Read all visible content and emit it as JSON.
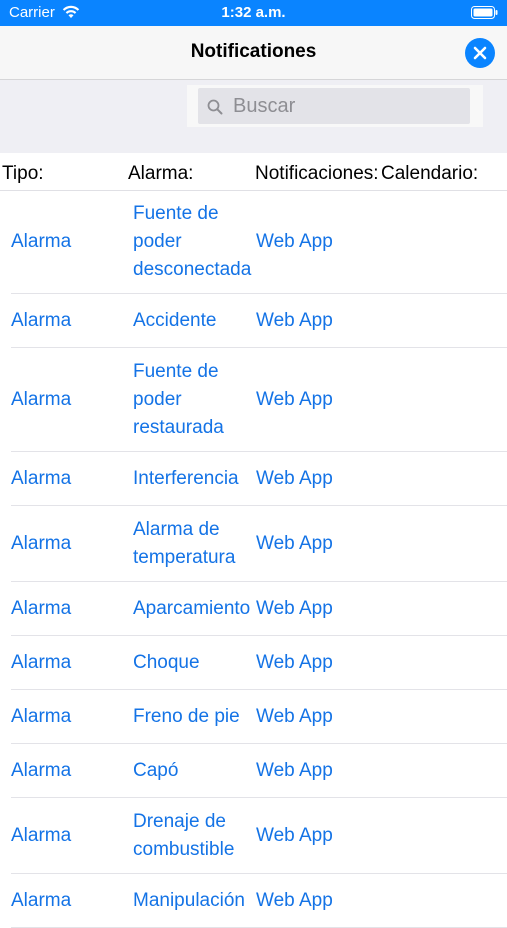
{
  "status_bar": {
    "carrier": "Carrier",
    "time": "1:32 a.m."
  },
  "nav": {
    "title": "Notificationes"
  },
  "search": {
    "placeholder": "Buscar"
  },
  "table": {
    "headers": [
      "Tipo:",
      "Alarma:",
      "Notificaciones:",
      "Calendario:"
    ],
    "rows": [
      {
        "tipo": "Alarma",
        "alarma": "Fuente de\npoder\ndesconectada",
        "notificaciones": "Web App",
        "calendario": ""
      },
      {
        "tipo": "Alarma",
        "alarma": "Accidente",
        "notificaciones": "Web App",
        "calendario": ""
      },
      {
        "tipo": "Alarma",
        "alarma": "Fuente de\npoder\nrestaurada",
        "notificaciones": "Web App",
        "calendario": ""
      },
      {
        "tipo": "Alarma",
        "alarma": "Interferencia",
        "notificaciones": "Web App",
        "calendario": ""
      },
      {
        "tipo": "Alarma",
        "alarma": "Alarma de\ntemperatura",
        "notificaciones": "Web App",
        "calendario": ""
      },
      {
        "tipo": "Alarma",
        "alarma": "Aparcamiento",
        "notificaciones": "Web App",
        "calendario": ""
      },
      {
        "tipo": "Alarma",
        "alarma": "Choque",
        "notificaciones": "Web App",
        "calendario": ""
      },
      {
        "tipo": "Alarma",
        "alarma": "Freno de pie",
        "notificaciones": "Web App",
        "calendario": ""
      },
      {
        "tipo": "Alarma",
        "alarma": "Capó",
        "notificaciones": "Web App",
        "calendario": ""
      },
      {
        "tipo": "Alarma",
        "alarma": "Drenaje de\ncombustible",
        "notificaciones": "Web App",
        "calendario": ""
      },
      {
        "tipo": "Alarma",
        "alarma": "Manipulación",
        "notificaciones": "Web App",
        "calendario": ""
      }
    ]
  },
  "icons": {
    "wifi": "wifi-icon",
    "battery": "battery-icon",
    "close": "close-icon",
    "search": "search-icon"
  },
  "colors": {
    "accent": "#0a84ff",
    "link": "#1473e6"
  }
}
